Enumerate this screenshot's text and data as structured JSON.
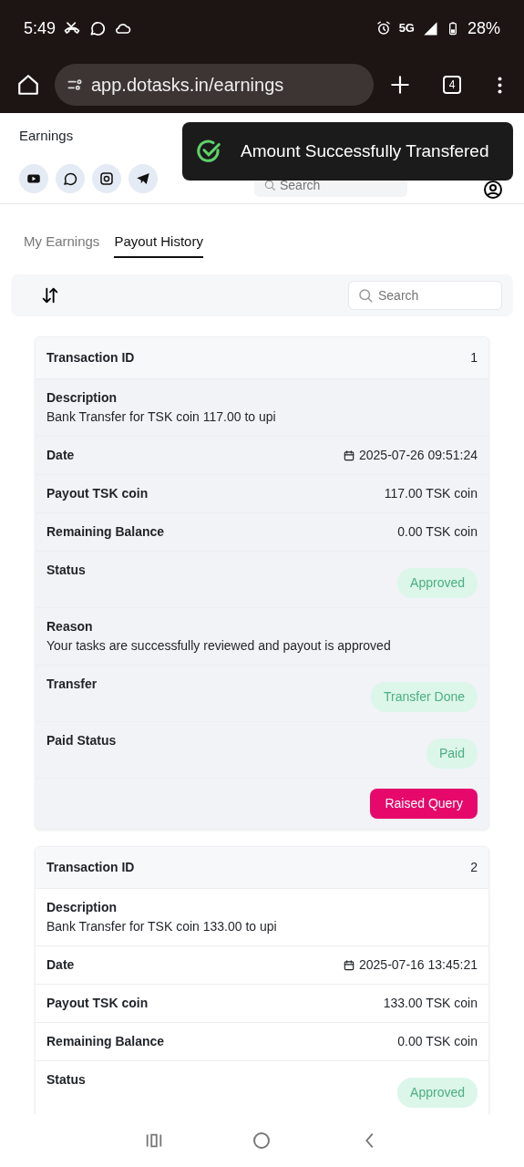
{
  "status_bar": {
    "time": "5:49",
    "network": "5G",
    "battery": "28%"
  },
  "browser": {
    "url": "app.dotasks.in/earnings",
    "tab_count": "4"
  },
  "header": {
    "title": "Earnings",
    "search": {
      "placeholder": "Search"
    }
  },
  "toast": {
    "message": "Amount Successfully Transfered"
  },
  "tabs": [
    {
      "label": "My Earnings",
      "selected": false
    },
    {
      "label": "Payout History",
      "selected": true
    }
  ],
  "toolbar": {
    "search": {
      "placeholder": "Search"
    }
  },
  "transactions": [
    {
      "highlighted": true,
      "rows": [
        {
          "kind": "header",
          "label": "Transaction ID",
          "value": "1"
        },
        {
          "kind": "stacked",
          "label": "Description",
          "value": "Bank Transfer for TSK coin 117.00 to upi"
        },
        {
          "kind": "date",
          "label": "Date",
          "value": "2025-07-26 09:51:24"
        },
        {
          "kind": "pair",
          "label": "Payout TSK coin",
          "value": "117.00 TSK coin"
        },
        {
          "kind": "pair",
          "label": "Remaining Balance",
          "value": "0.00 TSK coin"
        },
        {
          "kind": "badge",
          "label": "Status",
          "value": "Approved"
        },
        {
          "kind": "stacked",
          "label": "Reason",
          "value": "Your tasks are successfully reviewed and payout is approved"
        },
        {
          "kind": "badge",
          "label": "Transfer",
          "value": "Transfer Done"
        },
        {
          "kind": "badge",
          "label": "Paid Status",
          "value": "Paid"
        },
        {
          "kind": "action",
          "value": "Raised Query"
        }
      ]
    },
    {
      "highlighted": false,
      "rows": [
        {
          "kind": "header",
          "label": "Transaction ID",
          "value": "2"
        },
        {
          "kind": "stacked",
          "label": "Description",
          "value": "Bank Transfer for TSK coin 133.00 to upi"
        },
        {
          "kind": "date",
          "label": "Date",
          "value": "2025-07-16 13:45:21"
        },
        {
          "kind": "pair",
          "label": "Payout TSK coin",
          "value": "133.00 TSK coin"
        },
        {
          "kind": "pair",
          "label": "Remaining Balance",
          "value": "0.00 TSK coin"
        },
        {
          "kind": "badge",
          "label": "Status",
          "value": "Approved"
        }
      ]
    }
  ]
}
